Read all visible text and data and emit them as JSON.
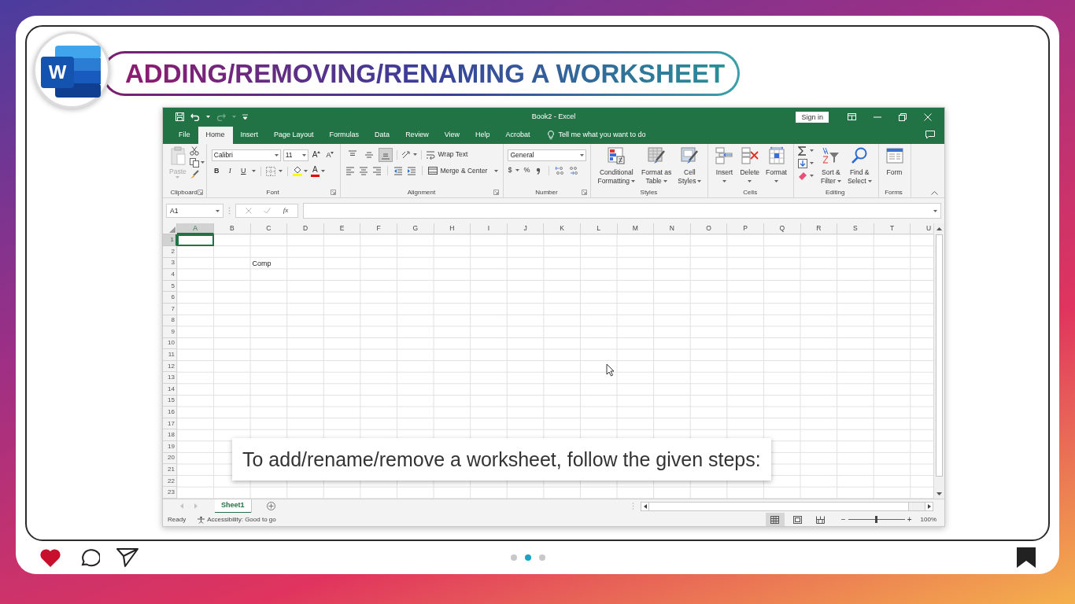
{
  "post": {
    "logo": {
      "letter": "W"
    },
    "title": "ADDING/REMOVING/RENAMING A WORKSHEET",
    "caption": "To add/rename/remove a worksheet, follow the given steps:",
    "dots": [
      {
        "selected": false
      },
      {
        "selected": true
      },
      {
        "selected": false
      }
    ]
  },
  "excel": {
    "quick_access": [
      {
        "kind": "save",
        "disabled": false
      },
      {
        "kind": "undo",
        "disabled": false
      },
      {
        "kind": "redo",
        "disabled": true
      }
    ],
    "window_title": "Book2 - Excel",
    "sign_in": "Sign in",
    "tabs": [
      {
        "label": "File",
        "selected": false
      },
      {
        "label": "Home",
        "selected": true
      },
      {
        "label": "Insert",
        "selected": false
      },
      {
        "label": "Page Layout",
        "selected": false
      },
      {
        "label": "Formulas",
        "selected": false
      },
      {
        "label": "Data",
        "selected": false
      },
      {
        "label": "Review",
        "selected": false
      },
      {
        "label": "View",
        "selected": false
      },
      {
        "label": "Help",
        "selected": false
      },
      {
        "label": "Acrobat",
        "selected": false
      }
    ],
    "tell_me": "Tell me what you want to do",
    "ribbon": [
      {
        "kind": "clipboard",
        "label": "Clipboard",
        "paste": "Paste",
        "paste_disabled": true,
        "launcher": true
      },
      {
        "kind": "font",
        "label": "Font",
        "font_name": "Calibri",
        "font_size": "11",
        "size_buttons": [
          "A",
          "A"
        ],
        "style_buttons": [
          "B",
          "I",
          "U"
        ],
        "color_buttons": [
          {
            "kind": "fill",
            "color": "#ffff00"
          },
          {
            "kind": "text",
            "label": "A",
            "color": "#e00000"
          }
        ],
        "launcher": true
      },
      {
        "kind": "alignment",
        "label": "Alignment",
        "vertical": [
          {
            "selected": false
          },
          {
            "selected": false
          },
          {
            "selected": true
          }
        ],
        "wrap": "Wrap Text",
        "merge": "Merge & Center",
        "launcher": true
      },
      {
        "kind": "number",
        "label": "Number",
        "format": "General",
        "symbols": [
          "$",
          "%"
        ],
        "launcher": true
      },
      {
        "kind": "styles",
        "label": "Styles",
        "buttons": [
          {
            "lines": [
              "Conditional",
              "Formatting"
            ],
            "dropdown": true
          },
          {
            "lines": [
              "Format as",
              "Table"
            ],
            "dropdown": true
          },
          {
            "lines": [
              "Cell",
              "Styles"
            ],
            "dropdown": true
          }
        ]
      },
      {
        "kind": "cells",
        "label": "Cells",
        "buttons": [
          {
            "lines": [
              "Insert"
            ],
            "dropdown": true
          },
          {
            "lines": [
              "Delete"
            ],
            "dropdown": true
          },
          {
            "lines": [
              "Format"
            ],
            "dropdown": true
          }
        ]
      },
      {
        "kind": "editing",
        "label": "Editing",
        "buttons": [
          {
            "lines": [
              "Sort &",
              "Filter"
            ],
            "dropdown": true
          },
          {
            "lines": [
              "Find &",
              "Select"
            ],
            "dropdown": true
          }
        ]
      },
      {
        "kind": "forms",
        "label": "Forms",
        "buttons": [
          {
            "lines": [
              "Form"
            ],
            "dropdown": false
          }
        ]
      }
    ],
    "name_box": "A1",
    "fx": "fx",
    "columns": [
      {
        "label": "A",
        "selected": true
      },
      {
        "label": "B",
        "selected": false
      },
      {
        "label": "C",
        "selected": false
      },
      {
        "label": "D",
        "selected": false
      },
      {
        "label": "E",
        "selected": false
      },
      {
        "label": "F",
        "selected": false
      },
      {
        "label": "G",
        "selected": false
      },
      {
        "label": "H",
        "selected": false
      },
      {
        "label": "I",
        "selected": false
      },
      {
        "label": "J",
        "selected": false
      },
      {
        "label": "K",
        "selected": false
      },
      {
        "label": "L",
        "selected": false
      },
      {
        "label": "M",
        "selected": false
      },
      {
        "label": "N",
        "selected": false
      },
      {
        "label": "O",
        "selected": false
      },
      {
        "label": "P",
        "selected": false
      },
      {
        "label": "Q",
        "selected": false
      },
      {
        "label": "R",
        "selected": false
      },
      {
        "label": "S",
        "selected": false
      },
      {
        "label": "T",
        "selected": false
      },
      {
        "label": "U",
        "selected": false
      }
    ],
    "rows": [
      {
        "label": "1",
        "selected": true
      },
      {
        "label": "2",
        "selected": false
      },
      {
        "label": "3",
        "selected": false,
        "cells": {
          "c": "Comp"
        }
      },
      {
        "label": "4",
        "selected": false
      },
      {
        "label": "5",
        "selected": false
      },
      {
        "label": "6",
        "selected": false
      },
      {
        "label": "7",
        "selected": false
      },
      {
        "label": "8",
        "selected": false
      },
      {
        "label": "9",
        "selected": false
      },
      {
        "label": "10",
        "selected": false
      },
      {
        "label": "11",
        "selected": false
      },
      {
        "label": "12",
        "selected": false
      },
      {
        "label": "13",
        "selected": false
      },
      {
        "label": "14",
        "selected": false
      },
      {
        "label": "15",
        "selected": false
      },
      {
        "label": "16",
        "selected": false
      },
      {
        "label": "17",
        "selected": false
      },
      {
        "label": "18",
        "selected": false
      },
      {
        "label": "19",
        "selected": false
      },
      {
        "label": "20",
        "selected": false
      },
      {
        "label": "21",
        "selected": false
      },
      {
        "label": "22",
        "selected": false
      },
      {
        "label": "23",
        "selected": false
      }
    ],
    "sheets": [
      {
        "label": "Sheet1",
        "selected": true
      }
    ],
    "status": "Ready",
    "accessibility": "Accessibility: Good to go",
    "views": [
      {
        "kind": "normal",
        "selected": true
      },
      {
        "kind": "page_layout",
        "selected": false
      },
      {
        "kind": "page_break",
        "selected": false
      }
    ],
    "zoom": {
      "minus": "−",
      "plus": "+",
      "level": 0.5,
      "reading": "100%"
    }
  }
}
